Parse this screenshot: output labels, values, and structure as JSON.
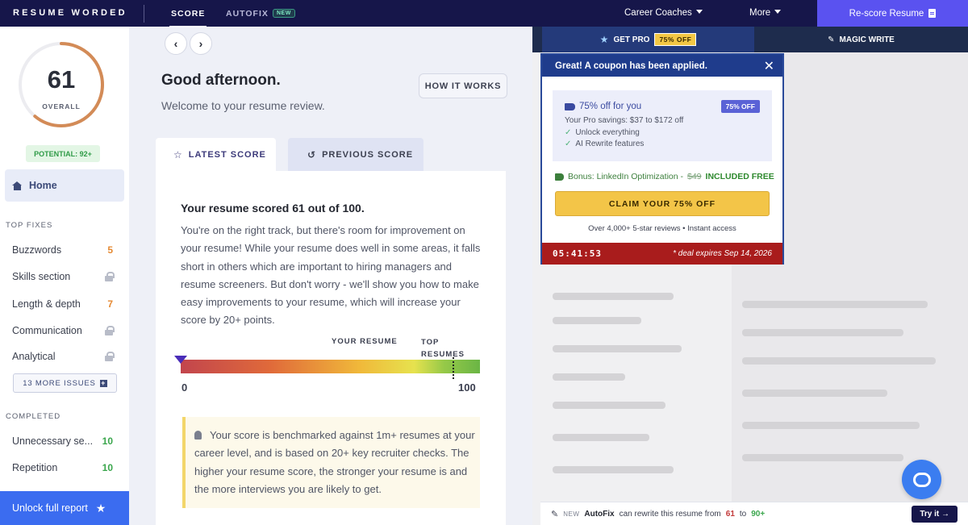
{
  "nav": {
    "logo": "RESUME WORDED",
    "tab_score": "SCORE",
    "tab_autofix": "AUTOFIX",
    "new_badge": "NEW",
    "career_coaches": "Career Coaches",
    "more": "More",
    "rescore": "Re-score Resume"
  },
  "sidebar": {
    "score": "61",
    "score_label": "OVERALL",
    "score_fraction": 0.61,
    "potential": "POTENTIAL: 92+",
    "home": "Home",
    "top_fixes_heading": "TOP FIXES",
    "top_fixes": [
      {
        "label": "Buzzwords",
        "value": "5",
        "locked": false
      },
      {
        "label": "Skills section",
        "value": "",
        "locked": true
      },
      {
        "label": "Length & depth",
        "value": "7",
        "locked": false
      },
      {
        "label": "Communication",
        "value": "",
        "locked": true
      },
      {
        "label": "Analytical",
        "value": "",
        "locked": true
      }
    ],
    "more_issues": "13 MORE ISSUES",
    "completed_heading": "COMPLETED",
    "completed": [
      {
        "label": "Unnecessary se...",
        "value": "10"
      },
      {
        "label": "Repetition",
        "value": "10"
      }
    ],
    "unlock": "Unlock full report"
  },
  "main": {
    "greeting": "Good afternoon.",
    "welcome": "Welcome to your resume review.",
    "how_it_works": "HOW IT WORKS",
    "tab_latest": "LATEST SCORE",
    "tab_previous": "PREVIOUS SCORE",
    "result_title": "Your resume scored 61 out of 100.",
    "result_body": "You're on the right track, but there's room for improvement on your resume! While your resume does well in some areas, it falls short in others which are important to hiring managers and resume screeners. But don't worry - we'll show you how to make easy improvements to your resume, which will increase your score by 20+ points.",
    "label_your_resume": "YOUR RESUME",
    "label_top_resumes": "TOP RESUMES",
    "scale_min": "0",
    "scale_max": "100",
    "tip": "Your score is benchmarked against 1m+ resumes at your career level, and is based on 20+ key recruiter checks. The higher your resume score, the stronger your resume is and the more interviews you are likely to get."
  },
  "right": {
    "get_pro": "GET PRO",
    "get_pro_badge": "75% OFF",
    "magic_write": "MAGIC WRITE"
  },
  "popup": {
    "header": "Great! A coupon has been applied.",
    "offer_title": "75% off for you",
    "offer_badge": "75% OFF",
    "savings": "Your Pro savings: $37 to $172 off",
    "feature1": "Unlock everything",
    "feature2": "AI Rewrite features",
    "bonus_prefix": "Bonus: LinkedIn Optimization -",
    "bonus_price": "$49",
    "bonus_free": "INCLUDED FREE",
    "claim": "CLAIM YOUR 75% OFF",
    "reviews": "Over 4,000+ 5-star reviews • Instant access",
    "timer": "05:41:53",
    "deal": "* deal expires Sep 14, 2026"
  },
  "autofix_bar": {
    "new": "NEW",
    "name": "AutoFix",
    "text_mid": "can rewrite this resume from",
    "from": "61",
    "to_word": "to",
    "to": "90+",
    "try": "Try it →"
  }
}
